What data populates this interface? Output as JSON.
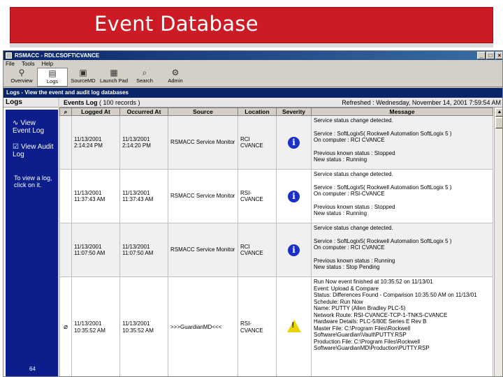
{
  "slide": {
    "title": "Event Database",
    "number": "64"
  },
  "window": {
    "title": "RSMACC - RDLCSOFT\\CVANCE"
  },
  "menu": [
    "File",
    "Tools",
    "Help"
  ],
  "toolbar": [
    {
      "label": "Overview",
      "icon": "overview-icon"
    },
    {
      "label": "Logs",
      "icon": "logs-icon"
    },
    {
      "label": "SourceMD",
      "icon": "sourcemd-icon"
    },
    {
      "label": "Launch Pad",
      "icon": "launchpad-icon"
    },
    {
      "label": "Search",
      "icon": "search-icon"
    },
    {
      "label": "Admin",
      "icon": "admin-icon"
    }
  ],
  "section": {
    "title": "Logs - View the event and audit log databases"
  },
  "sidebar": {
    "heading": "Logs",
    "view_event_log": "View Event Log",
    "view_audit_log": "View Audit Log",
    "note": "To view a log, click on it."
  },
  "log": {
    "title": "Events Log",
    "count": "( 100 records )",
    "refreshed": "Refreshed : Wednesday, November 14, 2001 7:59:54 AM",
    "columns": [
      "Logged At",
      "Occurred At",
      "Source",
      "Location",
      "Severity",
      "Message"
    ],
    "rows": [
      {
        "logged": "11/13/2001 2:14:24 PM",
        "occurred": "11/13/2001 2:14:20 PM",
        "source": "RSMACC Service Monitor",
        "location": "RCI CVANCE",
        "severity": "info",
        "message": [
          "Service status change detected.",
          "",
          "Service : SoftLogix5( Rockwell Automation SoftLogix 5 )",
          "On computer : RCI CVANCE",
          "",
          "Previous known status : Stopped",
          "New status : Running"
        ]
      },
      {
        "logged": "11/13/2001 11:37:43 AM",
        "occurred": "11/13/2001 11:37:43 AM",
        "source": "RSMACC Service Monitor",
        "location": "RSI-CVANCE",
        "severity": "info",
        "message": [
          "Service status change detected.",
          "",
          "Service : SoftLogix5( Rockwell Automation SoftLogix 5 )",
          "On computer : RSI-CVANCE",
          "",
          "Previous known status : Stopped",
          "New status : Running"
        ]
      },
      {
        "logged": "11/13/2001 11:07:50 AM",
        "occurred": "11/13/2001 11:07:50 AM",
        "source": "RSMACC Service Monitor",
        "location": "RCI CVANCE",
        "severity": "info",
        "message": [
          "Service status change detected.",
          "",
          "Service : SoftLogix5( Rockwell Automation SoftLogix 5 )",
          "On computer : RCI CVANCE",
          "",
          "Previous known status : Running",
          "New status : Stop Pending"
        ]
      },
      {
        "logged": "11/13/2001 10:35:52 AM",
        "occurred": "11/13/2001 10:35:52 AM",
        "source": ">>>GuardianMD<<<",
        "location": "RSI-CVANCE",
        "severity": "warning",
        "message": [
          "Run Now event finished at 10:35:52 on 11/13/01",
          "Event: Upload & Compare",
          "Status: Differences Found - Comparison 10:35:50 AM on 11/13/01",
          "Schedule: Run Now",
          "Name: PUTTY (Allen Bradley PLC-5)",
          "Network Route: RSI-CVANCE-TCP-1-TNKS-CVANCE",
          "Hardware Details: PLC-5/80E Series E Rev B",
          "Master File: C:\\Program Files\\Rockwell",
          "Software\\Guardian\\Vault\\PUTTY.RSP",
          "Production File: C:\\Program Files\\Rockwell",
          "Software\\GuardianMD\\Production\\PUTTY.RSP"
        ]
      }
    ]
  }
}
